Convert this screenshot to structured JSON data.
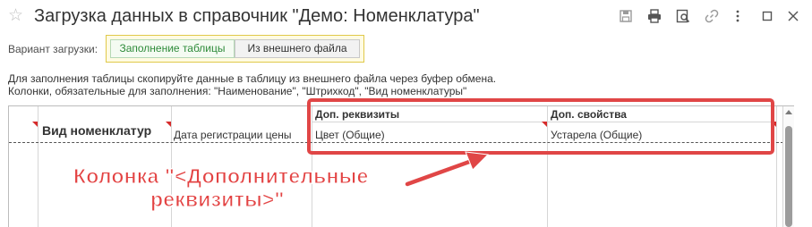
{
  "window": {
    "title": "Загрузка данных в справочник \"Демо: Номенклатура\"",
    "icons": [
      "star-icon",
      "save-icon",
      "print-icon",
      "preview-icon",
      "link-icon",
      "more-icon",
      "maximize-icon",
      "close-icon"
    ]
  },
  "load_variant": {
    "label": "Вариант загрузки:",
    "options": [
      {
        "label": "Заполнение таблицы",
        "selected": true
      },
      {
        "label": "Из внешнего файла",
        "selected": false
      }
    ]
  },
  "info": {
    "line1": "Для заполнения таблицы скопируйте данные в таблицу из внешнего файла через буфер обмена.",
    "line2": "Колонки, обязательные для заполнения: \"Наименование\", \"Штрихкод\", \"Вид номенклатуры\""
  },
  "table": {
    "group_headers": {
      "extra_attributes": "Доп. реквизиты",
      "extra_properties": "Доп. свойства"
    },
    "columns": [
      {
        "label": "Вид номенклатур",
        "required": true
      },
      {
        "label": "Дата регистрации цены",
        "required": false
      },
      {
        "label": "Цвет (Общие)",
        "required": false
      },
      {
        "label": "Устарела (Общие)",
        "required": true
      }
    ]
  },
  "annotation": {
    "line1": "Колонка \"<Дополнительные",
    "line2": "реквизиты>\"",
    "color": "#e34343"
  },
  "colors": {
    "accent_green": "#2e8b3a",
    "highlight_red": "#e04646",
    "required_marker": "#d62b2b"
  }
}
